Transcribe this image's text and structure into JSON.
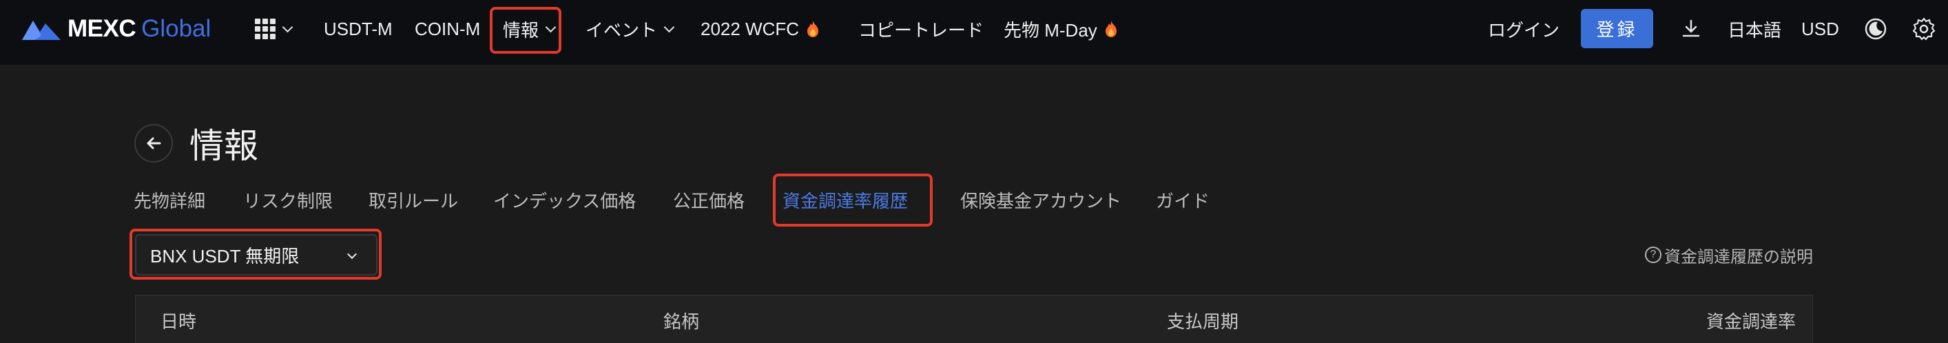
{
  "brand": {
    "name": "MEXC",
    "sub": "Global",
    "colors": {
      "accent": "#3a6fd8",
      "highlight": "#e03a2a",
      "active_tab": "#4b7be5"
    }
  },
  "nav": {
    "apps_icon": "grid-icon",
    "items": [
      {
        "label": "USDT-M"
      },
      {
        "label": "COIN-M"
      },
      {
        "label": "情報"
      },
      {
        "label": "イベント"
      },
      {
        "label": "2022 WCFC"
      },
      {
        "label": "コピートレード"
      },
      {
        "label": "先物 M-Day"
      }
    ]
  },
  "header_right": {
    "login": "ログイン",
    "register": "登録",
    "language": "日本語",
    "currency": "USD"
  },
  "page": {
    "title": "情報",
    "tabs": [
      {
        "label": "先物詳細"
      },
      {
        "label": "リスク制限"
      },
      {
        "label": "取引ルール"
      },
      {
        "label": "インデックス価格"
      },
      {
        "label": "公正価格"
      },
      {
        "label": "資金調達率履歴",
        "active": true
      },
      {
        "label": "保険基金アカウント"
      },
      {
        "label": "ガイド"
      }
    ],
    "contract_select": {
      "value": "BNX USDT 無期限"
    },
    "help_link": "資金調達履歴の説明",
    "table": {
      "columns": [
        "日時",
        "銘柄",
        "支払周期",
        "資金調達率"
      ]
    }
  }
}
